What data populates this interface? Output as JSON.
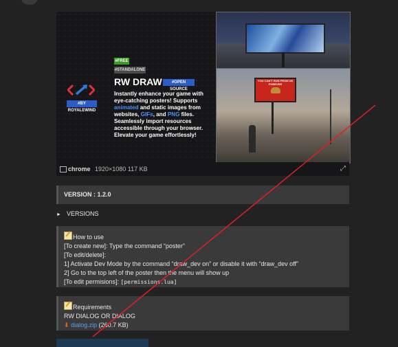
{
  "banner": {
    "tag_free": "#FREE",
    "tag_standalone": "#STANDALONE",
    "title": "RW DRAW",
    "tag_open_source": "#OPEN SOURCE",
    "by_badge": "#BY ROYALEWIND",
    "desc_1": "Instantly enhance your game with eye-catching posters! Supports ",
    "desc_animated": "animated",
    "desc_2": " and static images from websites, ",
    "desc_gifs": "GIFs",
    "desc_3": ", and ",
    "desc_png": "PNG",
    "desc_4": " files. Seamlessly import resources accessible through your browser. Elevate your game effortlessly!",
    "billboard_text": "YOU CAN'T RUN FROM US FOREVER"
  },
  "image_meta": {
    "filename": "chrome",
    "info": "1920×1080 117 KB",
    "expand_icon": "expand-icon"
  },
  "version_text": "VERSION : 1.2.0",
  "details_summary": "VERSIONS",
  "howto": {
    "title": "How to use",
    "line1": "[To create new]: Type the command “poster”",
    "line2": "[To edit/delete]:",
    "line3": "1] Activate Dev Mode by the command “draw_dev on” or disable it with “draw_dev off”",
    "line4": "2] Go to the top left of the poster then the menu will show up",
    "line5_prefix": "[To edit permisions]: ",
    "line5_code": "[permissions.lua]"
  },
  "requirements": {
    "title": "Requirements",
    "line1": "RW DIALOG OR DIALOG",
    "download_link": "dialog.zip",
    "download_size": "(260.7 KB)"
  },
  "colors": {
    "background": "#222222",
    "block": "#3a3a3a",
    "link": "#5aa0e8",
    "annotation_line": "#e02020"
  }
}
